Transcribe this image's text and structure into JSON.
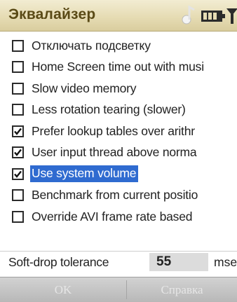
{
  "app": {
    "title": "Эквалайзер"
  },
  "options": [
    {
      "label": "Отключать подсветку",
      "checked": false,
      "selected": false
    },
    {
      "label": "Home Screen time out with musi",
      "checked": false,
      "selected": false
    },
    {
      "label": "Slow video memory",
      "checked": false,
      "selected": false
    },
    {
      "label": "Less rotation tearing (slower)",
      "checked": false,
      "selected": false
    },
    {
      "label": "Prefer lookup tables over arithr",
      "checked": true,
      "selected": false
    },
    {
      "label": "User input thread above norma",
      "checked": true,
      "selected": false
    },
    {
      "label": "Use system volume",
      "checked": true,
      "selected": true
    },
    {
      "label": "Benchmark from current positio",
      "checked": false,
      "selected": false
    },
    {
      "label": "Override AVI frame rate based",
      "checked": false,
      "selected": false
    }
  ],
  "soft_drop": {
    "label": "Soft-drop tolerance",
    "value": "55",
    "unit": "mse"
  },
  "softkeys": {
    "left": "OK",
    "right": "Справка"
  },
  "colors": {
    "title_text": "#5a4a16",
    "selection": "#2f6bd0"
  }
}
